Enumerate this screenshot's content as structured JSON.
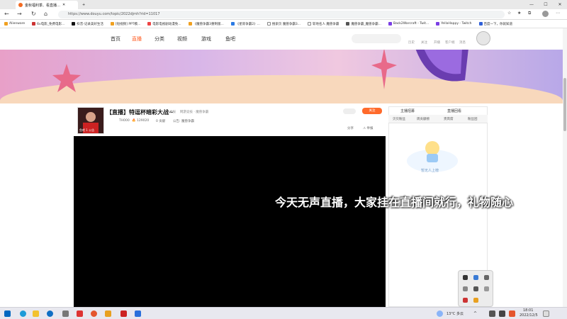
{
  "browser": {
    "tabs": [
      {
        "label": "金秋福利季、看直播…"
      },
      {
        "label": "新标签页"
      }
    ],
    "new_tab": "+",
    "url": "https://www.douyu.com/topic/2022djmh?rid=11017",
    "bookmarks": [
      "Alienware",
      "6v电影_免费电影...",
      "抖音-记录美好生活",
      "[短视频] PPT模...",
      "电影电视剧动漫免...",
      "《魔兽争霸3重制版...",
      "《星际争霸2》...",
      "搜索页 魔兽争霸3...",
      "斩地名人 魔兽争霸",
      "魔兽争霸_魔兽争霸...",
      "Back2Warcraft - Twit...",
      "YellaHappy - Twitch",
      "百度一下，你就知道"
    ]
  },
  "site": {
    "nav": [
      "首页",
      "直播",
      "分类",
      "视频",
      "游戏",
      "鱼吧"
    ],
    "header_links": [
      "历史",
      "关注",
      "开播",
      "客户端",
      "消息"
    ],
    "room": {
      "title": "【直播】特逗杯暗彩大战~",
      "category": "举报",
      "tags": "网游竞技 · 魔兽争霸",
      "owner": "TH000",
      "heat": "129020",
      "share": "分享",
      "follow": "关注",
      "avatar_caption": "鱼吧 1 公告",
      "fans": "0 贡献",
      "notice": "公告: 魔兽争霸"
    },
    "subtitle": "今天无声直播，大家挂在直播间就行，礼物随心",
    "panel": {
      "tabs": [
        "主播招募",
        "直播回看"
      ],
      "subtabs": [
        "贝贝粉丝",
        "周贡献榜",
        "贵宾席",
        "粉丝团"
      ],
      "placeholder": "暂无人上榜"
    }
  },
  "taskbar": {
    "weather": "13°C 多云",
    "time": "18:01",
    "date": "2022/12/5"
  }
}
